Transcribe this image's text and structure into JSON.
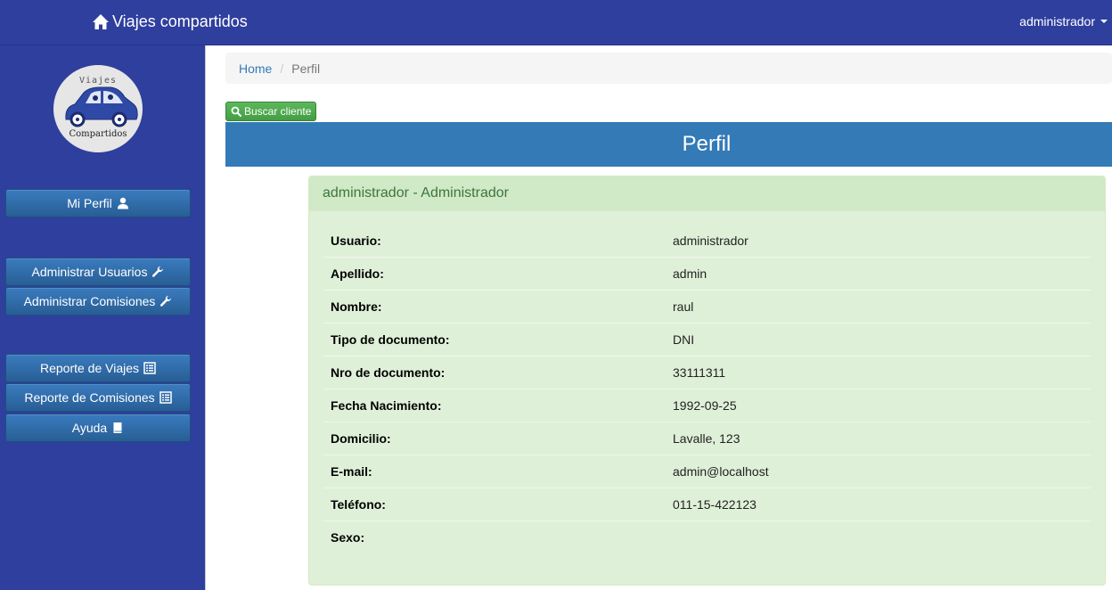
{
  "navbar": {
    "brand": "Viajes compartidos",
    "user": "administrador"
  },
  "logo": {
    "top_text": "Viajes",
    "bottom_text": "Compartidos"
  },
  "sidebar": {
    "items": [
      {
        "label": "Mi Perfil",
        "icon": "user-icon"
      },
      {
        "label": "Administrar Usuarios",
        "icon": "wrench-icon"
      },
      {
        "label": "Administrar Comisiones",
        "icon": "wrench-icon"
      },
      {
        "label": "Reporte de Viajes",
        "icon": "list-alt-icon"
      },
      {
        "label": "Reporte de Comisiones",
        "icon": "list-alt-icon"
      },
      {
        "label": "Ayuda",
        "icon": "book-icon"
      }
    ]
  },
  "breadcrumb": {
    "home": "Home",
    "current": "Perfil"
  },
  "search_button": "Buscar cliente",
  "title": "Perfil",
  "panel": {
    "heading": "administrador - Administrador",
    "rows": [
      {
        "label": "Usuario:",
        "value": "administrador"
      },
      {
        "label": "Apellido:",
        "value": "admin"
      },
      {
        "label": "Nombre:",
        "value": "raul"
      },
      {
        "label": "Tipo de documento:",
        "value": "DNI"
      },
      {
        "label": "Nro de documento:",
        "value": "33111311"
      },
      {
        "label": "Fecha Nacimiento:",
        "value": "1992-09-25"
      },
      {
        "label": "Domicilio:",
        "value": "Lavalle, 123"
      },
      {
        "label": "E-mail:",
        "value": "admin@localhost"
      },
      {
        "label": "Teléfono:",
        "value": "011-15-422123"
      },
      {
        "label": "Sexo:",
        "value": ""
      }
    ]
  },
  "colors": {
    "navbar": "#2f3f9e",
    "primary": "#337ab7",
    "success": "#5cb85c",
    "panel_bg": "#dff0d8",
    "panel_text": "#3c763d"
  }
}
